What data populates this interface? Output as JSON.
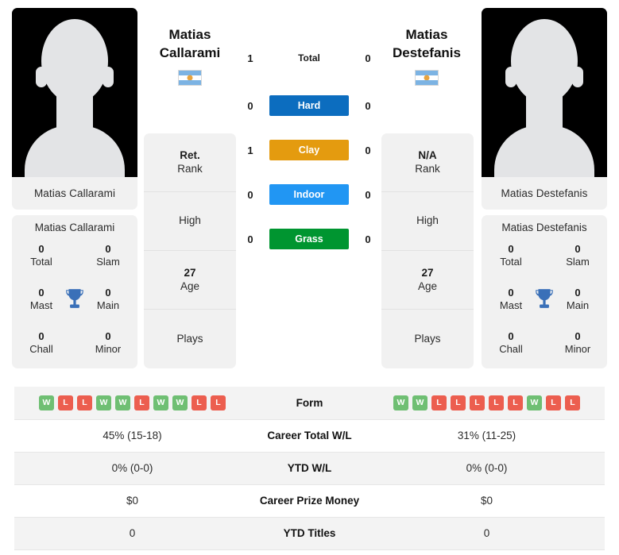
{
  "players": {
    "left": {
      "first_name": "Matias",
      "last_name": "Callarami",
      "full_name": "Matias Callarami",
      "flag": "argentina-flag",
      "rank_value": "Ret.",
      "rank_label": "Rank",
      "high_value": "",
      "high_label": "High",
      "age_value": "27",
      "age_label": "Age",
      "plays_value": "",
      "plays_label": "Plays",
      "titles": {
        "total_value": "0",
        "total_label": "Total",
        "slam_value": "0",
        "slam_label": "Slam",
        "mast_value": "0",
        "mast_label": "Mast",
        "main_value": "0",
        "main_label": "Main",
        "chall_value": "0",
        "chall_label": "Chall",
        "minor_value": "0",
        "minor_label": "Minor"
      },
      "form": [
        "W",
        "L",
        "L",
        "W",
        "W",
        "L",
        "W",
        "W",
        "L",
        "L"
      ],
      "career_total_wl": "45% (15-18)",
      "ytd_wl": "0% (0-0)",
      "career_prize_money": "$0",
      "ytd_titles": "0"
    },
    "right": {
      "first_name": "Matias",
      "last_name": "Destefanis",
      "full_name": "Matias Destefanis",
      "flag": "argentina-flag",
      "rank_value": "N/A",
      "rank_label": "Rank",
      "high_value": "",
      "high_label": "High",
      "age_value": "27",
      "age_label": "Age",
      "plays_value": "",
      "plays_label": "Plays",
      "titles": {
        "total_value": "0",
        "total_label": "Total",
        "slam_value": "0",
        "slam_label": "Slam",
        "mast_value": "0",
        "mast_label": "Mast",
        "main_value": "0",
        "main_label": "Main",
        "chall_value": "0",
        "chall_label": "Chall",
        "minor_value": "0",
        "minor_label": "Minor"
      },
      "form": [
        "W",
        "W",
        "L",
        "L",
        "L",
        "L",
        "L",
        "W",
        "L",
        "L"
      ],
      "career_total_wl": "31% (11-25)",
      "ytd_wl": "0% (0-0)",
      "career_prize_money": "$0",
      "ytd_titles": "0"
    }
  },
  "head_to_head": [
    {
      "label": "Total",
      "left": "1",
      "right": "0",
      "color": "",
      "plain": true
    },
    {
      "label": "Hard",
      "left": "0",
      "right": "0",
      "color": "#0c6dbf",
      "plain": false
    },
    {
      "label": "Clay",
      "left": "1",
      "right": "0",
      "color": "#e49b0f",
      "plain": false
    },
    {
      "label": "Indoor",
      "left": "0",
      "right": "0",
      "color": "#2196f3",
      "plain": false
    },
    {
      "label": "Grass",
      "left": "0",
      "right": "0",
      "color": "#009530",
      "plain": false
    }
  ],
  "table_rows": [
    {
      "label": "Form",
      "type": "form"
    },
    {
      "label": "Career Total W/L",
      "type": "text",
      "key": "career_total_wl"
    },
    {
      "label": "YTD W/L",
      "type": "text",
      "key": "ytd_wl"
    },
    {
      "label": "Career Prize Money",
      "type": "text",
      "key": "career_prize_money"
    },
    {
      "label": "YTD Titles",
      "type": "text",
      "key": "ytd_titles"
    }
  ],
  "colors": {
    "card_bg": "#f1f1f1",
    "win": "#6fbf73",
    "loss": "#ec5e4f",
    "trophy": "#3a70b8"
  }
}
